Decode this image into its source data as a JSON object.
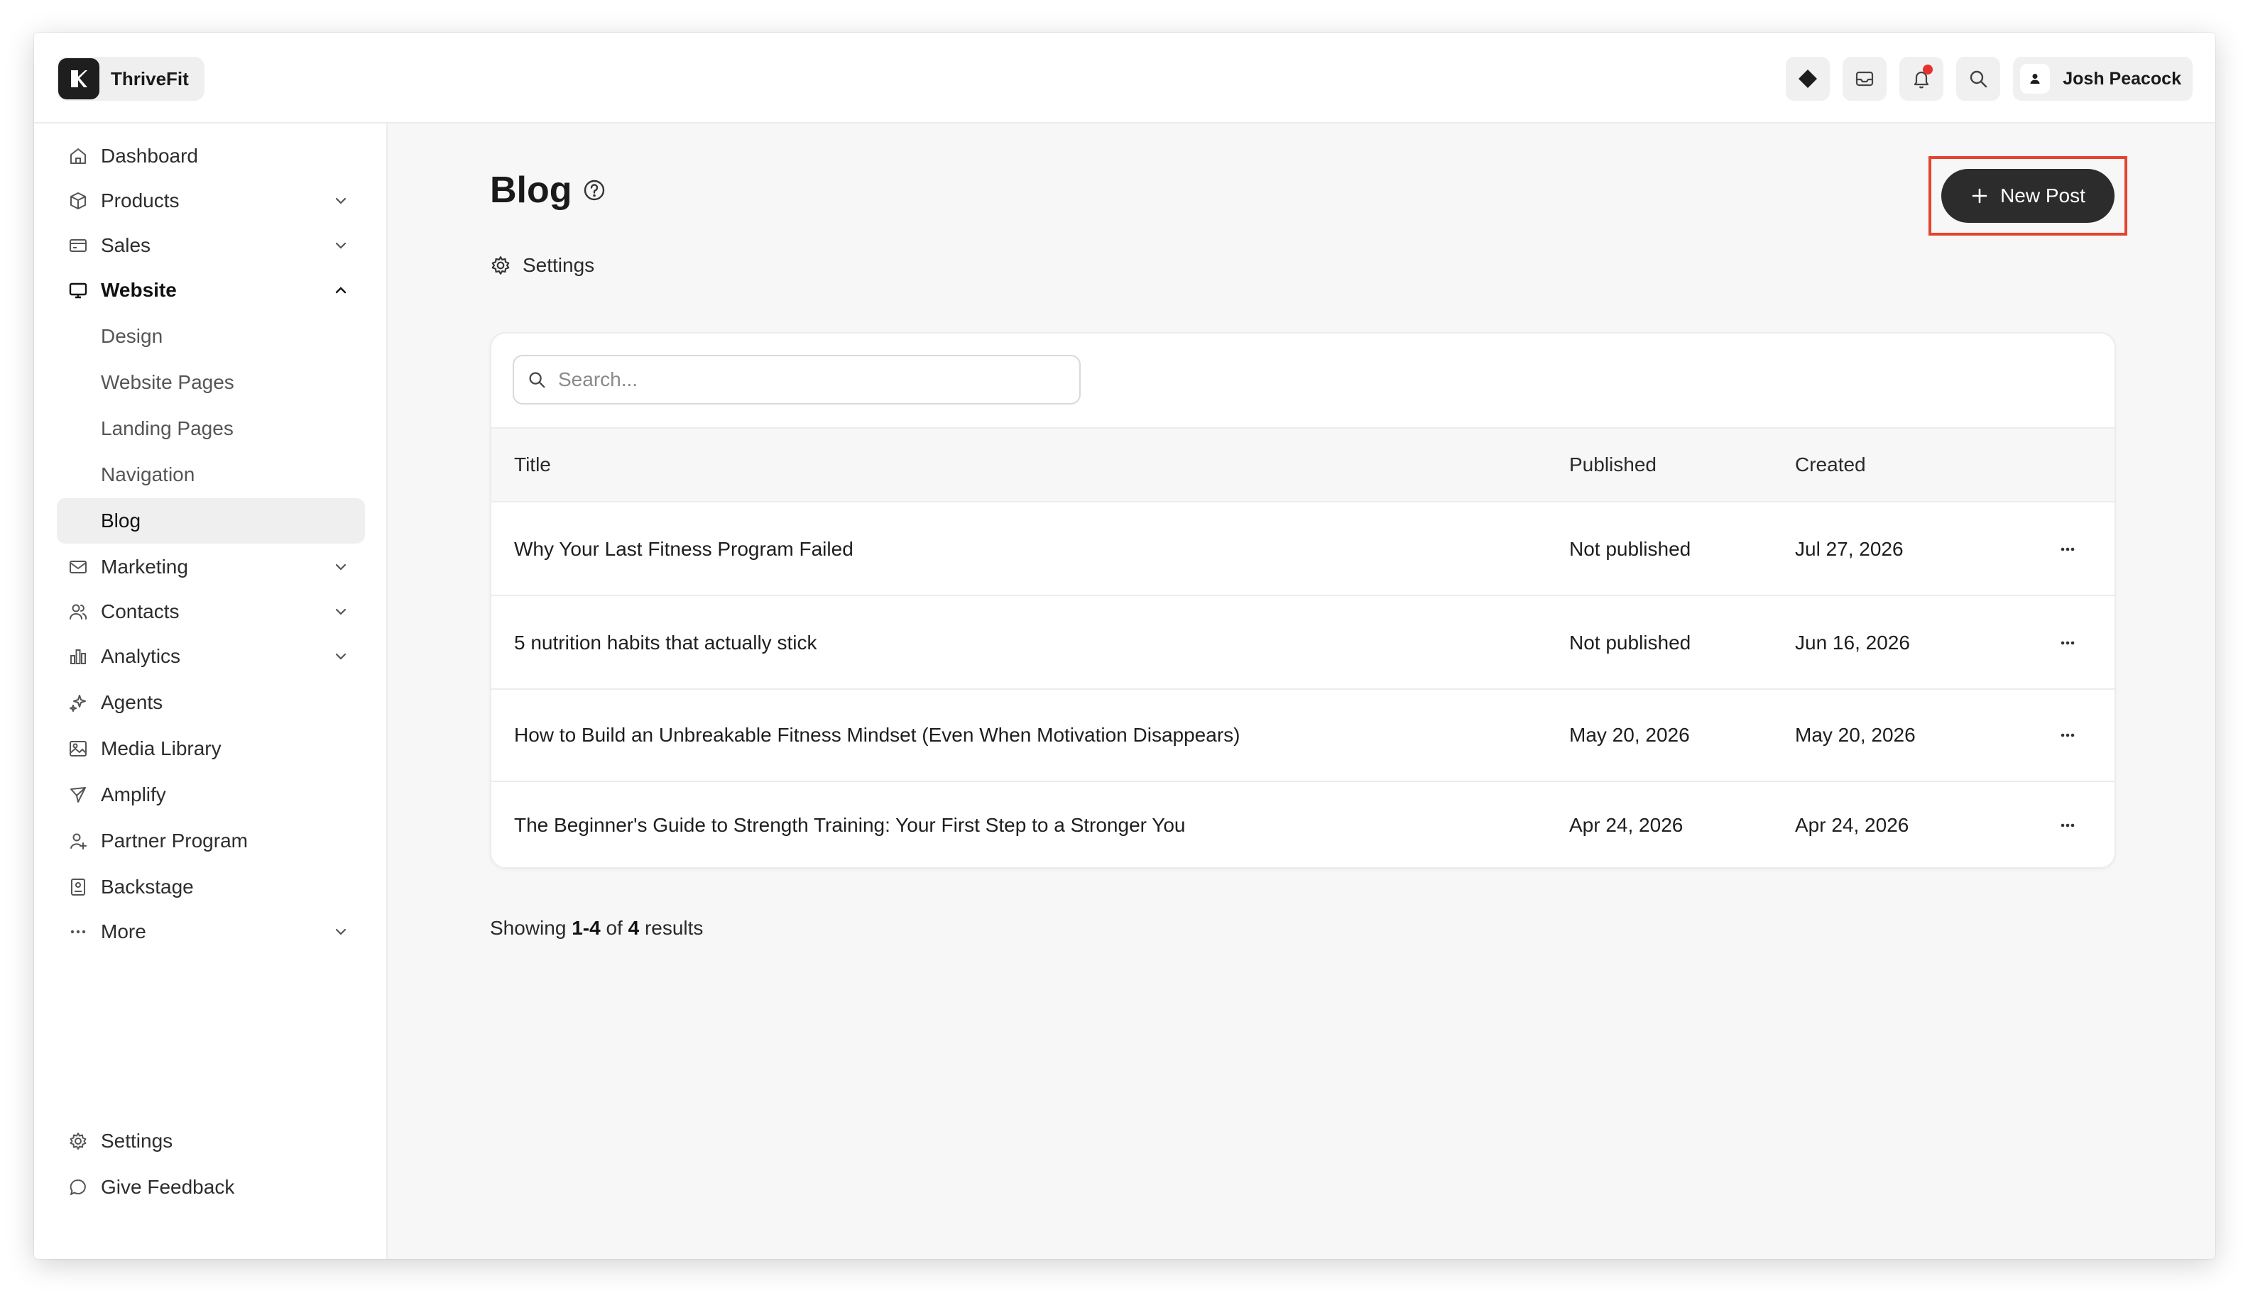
{
  "app": {
    "brand_name": "ThriveFit",
    "user_name": "Josh Peacock"
  },
  "sidebar": {
    "items": [
      {
        "label": "Dashboard",
        "icon": "home-icon"
      },
      {
        "label": "Products",
        "icon": "box-icon",
        "expandable": true
      },
      {
        "label": "Sales",
        "icon": "credit-card-icon",
        "expandable": true
      },
      {
        "label": "Website",
        "icon": "monitor-icon",
        "expanded": true
      },
      {
        "label": "Design"
      },
      {
        "label": "Website Pages"
      },
      {
        "label": "Landing Pages"
      },
      {
        "label": "Navigation"
      },
      {
        "label": "Blog",
        "selected": true
      },
      {
        "label": "Marketing",
        "icon": "mail-icon",
        "expandable": true
      },
      {
        "label": "Contacts",
        "icon": "users-icon",
        "expandable": true
      },
      {
        "label": "Analytics",
        "icon": "bar-chart-icon",
        "expandable": true
      },
      {
        "label": "Agents",
        "icon": "sparkle-icon"
      },
      {
        "label": "Media Library",
        "icon": "image-icon"
      },
      {
        "label": "Amplify",
        "icon": "send-icon"
      },
      {
        "label": "Partner Program",
        "icon": "user-plus-icon"
      },
      {
        "label": "Backstage",
        "icon": "badge-icon"
      },
      {
        "label": "More",
        "icon": "ellipsis-icon",
        "expandable": true
      }
    ],
    "footer": [
      {
        "label": "Settings",
        "icon": "gear-icon"
      },
      {
        "label": "Give Feedback",
        "icon": "chat-icon"
      }
    ]
  },
  "main": {
    "title": "Blog",
    "settings_label": "Settings",
    "new_post_label": "New Post",
    "search_placeholder": "Search...",
    "columns": [
      "Title",
      "Published",
      "Created"
    ],
    "rows": [
      {
        "title": "Why Your Last Fitness Program Failed",
        "published": "Not published",
        "created": "Jul 27, 2026"
      },
      {
        "title": "5 nutrition habits that actually stick",
        "published": "Not published",
        "created": "Jun 16, 2026"
      },
      {
        "title": "How to Build an Unbreakable Fitness Mindset (Even When Motivation Disappears)",
        "published": "May 20, 2026",
        "created": "May 20, 2026"
      },
      {
        "title": "The Beginner's Guide to Strength Training: Your First Step to a Stronger You",
        "published": "Apr 24, 2026",
        "created": "Apr 24, 2026"
      }
    ],
    "results": {
      "prefix": "Showing",
      "range": "1-4",
      "of": "of",
      "total": "4",
      "suffix": "results"
    }
  },
  "colors": {
    "accent_dark": "#2c2c2c",
    "highlight_border": "#e5432d",
    "notification_dot": "#e5322d"
  }
}
